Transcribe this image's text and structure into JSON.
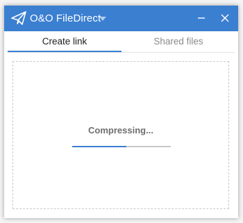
{
  "window": {
    "title": "O&O FileDirect",
    "icons": {
      "app": "paper-plane-icon",
      "dropdown": "caret-down-icon",
      "minimize": "minimize-icon",
      "close": "close-icon"
    },
    "colors": {
      "accent": "#3b7fd1",
      "title_text": "#ffffff"
    }
  },
  "tabs": [
    {
      "label": "Create link",
      "active": true
    },
    {
      "label": "Shared files",
      "active": false
    }
  ],
  "main": {
    "status": "Compressing...",
    "progress": 0.55
  }
}
